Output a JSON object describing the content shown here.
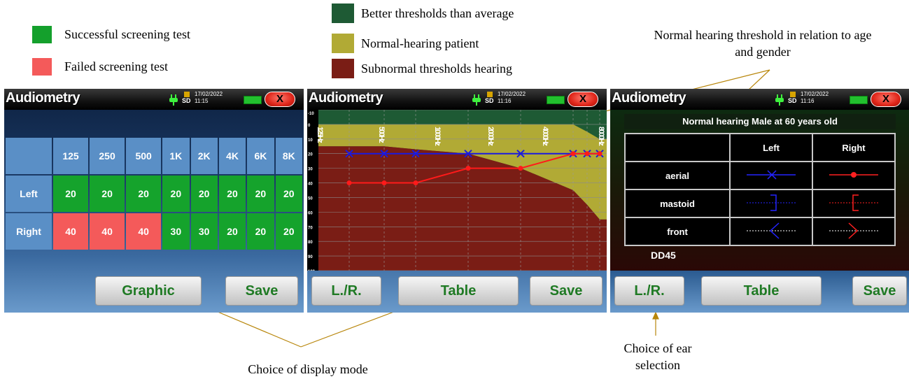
{
  "legend_left": [
    {
      "label": "Successful screening test",
      "color": "#14a02c"
    },
    {
      "label": "Failed screening test",
      "color": "#f45a5a"
    }
  ],
  "legend_center": [
    {
      "label": "Better thresholds than average",
      "color": "#1e5a34"
    },
    {
      "label": "Normal-hearing patient",
      "color": "#b1aa35"
    },
    {
      "label": "Subnormal thresholds hearing",
      "color": "#7a1d15"
    }
  ],
  "annotations": {
    "threshold_note": "Normal hearing threshold in relation to age and gender",
    "display_mode": "Choice of display mode",
    "ear_selection": "Choice of ear selection"
  },
  "screens": {
    "table_screen": {
      "title": "Audiometry",
      "date": "17/02/2022",
      "time": "11:15",
      "sd": "SD",
      "close": "X",
      "headers": [
        "125",
        "250",
        "500",
        "1K",
        "2K",
        "4K",
        "6K",
        "8K"
      ],
      "rows": [
        {
          "ear": "Left",
          "values": [
            "20",
            "20",
            "20",
            "20",
            "20",
            "20",
            "20",
            "20"
          ],
          "status": [
            "pass",
            "pass",
            "pass",
            "pass",
            "pass",
            "pass",
            "pass",
            "pass"
          ]
        },
        {
          "ear": "Right",
          "values": [
            "40",
            "40",
            "40",
            "30",
            "30",
            "20",
            "20",
            "20"
          ],
          "status": [
            "fail",
            "fail",
            "fail",
            "pass",
            "pass",
            "pass",
            "pass",
            "pass"
          ]
        }
      ],
      "buttons": {
        "graphic": "Graphic",
        "save": "Save"
      }
    },
    "graph_screen": {
      "title": "Audiometry",
      "date": "17/02/2022",
      "time": "11:16",
      "sd": "SD",
      "close": "X",
      "buttons": {
        "lr": "L./R.",
        "table": "Table",
        "save": "Save"
      },
      "y_ticks": [
        "-10",
        "0",
        "10",
        "20",
        "30",
        "40",
        "50",
        "60",
        "70",
        "80",
        "90",
        "100"
      ],
      "freq_labels": [
        "125Hz",
        "500Hz",
        "1000Hz",
        "2000Hz",
        "4000Hz",
        "8000Hz"
      ]
    },
    "legend_screen": {
      "title": "Audiometry",
      "date": "17/02/2022",
      "time": "11:16",
      "sd": "SD",
      "close": "X",
      "header": "Normal hearing Male at 60 years old",
      "col_left": "Left",
      "col_right": "Right",
      "rows": [
        "aerial",
        "mastoid",
        "front"
      ],
      "footer": "DD45",
      "buttons": {
        "lr": "L./R.",
        "table": "Table",
        "save": "Save"
      }
    }
  },
  "chart_data": {
    "type": "line",
    "x": [
      125,
      250,
      500,
      1000,
      2000,
      4000,
      6000,
      8000
    ],
    "series": [
      {
        "values": [
          20,
          20,
          20,
          20,
          20,
          20,
          20,
          20
        ],
        "color": "#1a1ae0",
        "marker": "x"
      },
      {
        "values": [
          40,
          40,
          40,
          30,
          30,
          20,
          20,
          20
        ],
        "color": "#ff1a1a",
        "marker": "dot"
      }
    ],
    "ylim": [
      -10,
      100
    ],
    "y_inverted": true,
    "normal_band_upper": [
      0,
      0,
      0,
      0,
      0,
      0,
      5,
      10
    ],
    "normal_band_lower": [
      15,
      15,
      17,
      20,
      30,
      45,
      55,
      65
    ]
  }
}
